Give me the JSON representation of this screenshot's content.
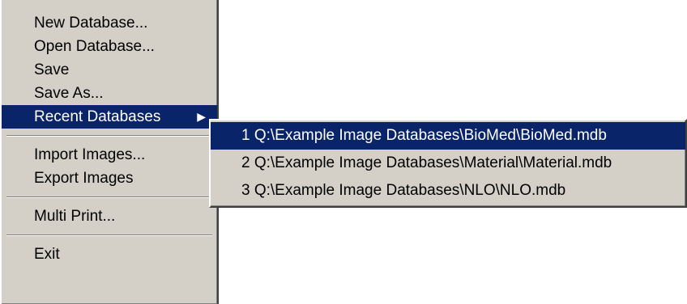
{
  "file_menu": {
    "new_database": "New Database...",
    "open_database": "Open Database...",
    "save": "Save",
    "save_as": "Save As...",
    "recent_databases": "Recent Databases",
    "import_images": "Import Images...",
    "export_images": "Export Images",
    "multi_print": "Multi Print...",
    "exit": "Exit"
  },
  "recent_submenu": {
    "items": [
      "1 Q:\\Example Image Databases\\BioMed\\BioMed.mdb",
      "2 Q:\\Example Image Databases\\Material\\Material.mdb",
      "3 Q:\\Example Image Databases\\NLO\\NLO.mdb"
    ]
  },
  "colors": {
    "menu_background": "#d4d0c8",
    "highlight": "#0a246a",
    "highlight_text": "#ffffff"
  }
}
